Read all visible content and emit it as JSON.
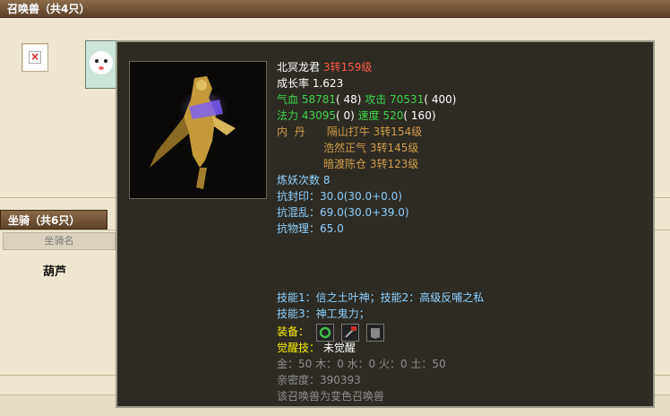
{
  "summon_bar": {
    "title": "召唤兽（共4只）"
  },
  "mount_tab": {
    "title": "坐骑（共6只）"
  },
  "mount_table": {
    "header": "坐骑名",
    "rows": [
      "葫芦"
    ]
  },
  "tooltip": {
    "name": "北冥龙君",
    "level": "3转159级",
    "growth_label": "成长率",
    "growth_value": "1.623",
    "hp_label": "气血",
    "hp_value": "58781",
    "hp_bonus": "( 48)",
    "atk_label": "攻击",
    "atk_value": "70531",
    "atk_bonus": "( 400)",
    "mp_label": "法力",
    "mp_value": "43095",
    "mp_bonus": "( 0)",
    "spd_label": "速度",
    "spd_value": "520",
    "spd_bonus": "( 160)",
    "dan_label": "内  丹",
    "dan": [
      {
        "name": "隔山打牛",
        "level": "3转154级"
      },
      {
        "name": "浩然正气",
        "level": "3转145级"
      },
      {
        "name": "暗渡陈仓",
        "level": "3转123级"
      }
    ],
    "refine_label": "炼妖次数",
    "refine_value": "8",
    "resist_seal": "抗封印：30.0(30.0+0.0)",
    "resist_chaos": "抗混乱：69.0(30.0+39.0)",
    "resist_phys": "抗物理：65.0",
    "skill1": "技能1：信之土叶神；技能2：高级反哺之私",
    "skill2": "技能3：神工鬼力；",
    "equip_label": "装备：",
    "awaken_label": "觉醒技：",
    "awaken_value": "未觉醒",
    "elements": "金：50 木：0 水：0 火：0 土：50",
    "intimacy": "亲密度：390393",
    "note": "该召唤兽为变色召唤兽"
  }
}
